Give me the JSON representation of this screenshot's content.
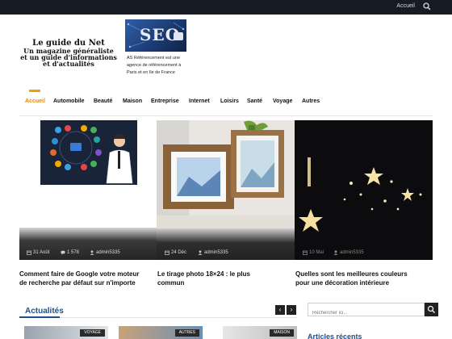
{
  "topbar": {
    "link": "Accueil",
    "search_icon": "search-icon"
  },
  "logo": {
    "line1": "Le guide du Net",
    "line2": "Un magazine généraliste",
    "line3": "et un guide d'informations",
    "line4": "et d'actualités"
  },
  "ad": {
    "image_text": "SEO",
    "text": "AS Référencement est une agence de référencement à Paris et en Ile de France"
  },
  "nav": {
    "items": [
      "Accueil",
      "Automobile",
      "Beauté",
      "Maison",
      "Entreprise",
      "Internet",
      "Loisirs",
      "Santé",
      "Voyage",
      "Autres"
    ],
    "active": "Accueil"
  },
  "featured": [
    {
      "date": "31 Août",
      "views": "1 578",
      "author": "admin5335",
      "title_l1": "Comment faire de Google votre moteur",
      "title_l2": "de recherche par défaut sur n'importe"
    },
    {
      "date": "24 Déc",
      "author": "admin5335",
      "title_l1": "Le tirage photo 18×24 : le plus",
      "title_l2": "commun"
    },
    {
      "date": "10 Mai",
      "author": "admin5335",
      "title_l1": "Quelles sont les meilleures couleurs",
      "title_l2": "pour une décoration intérieure"
    }
  ],
  "news": {
    "title": "Actualités",
    "prev": "‹",
    "next": "›"
  },
  "search": {
    "placeholder": "Rechercher ici..."
  },
  "thumbs": [
    {
      "tag": "VOYAGE"
    },
    {
      "tag": "AUTRES"
    },
    {
      "tag": "MAISON"
    }
  ],
  "recent": {
    "title": "Articles récents"
  },
  "colors": {
    "accent": "#f0a000",
    "active_nav": "#e58a00",
    "section_blue": "#1d4f91",
    "topbar": "#161b24"
  }
}
